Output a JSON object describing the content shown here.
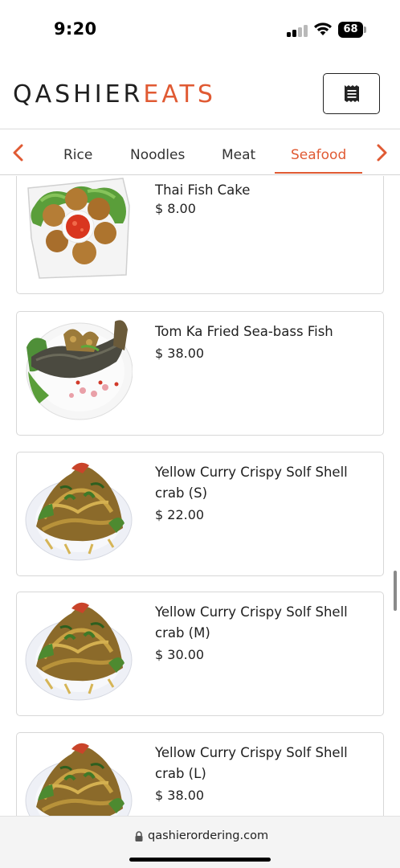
{
  "status_bar": {
    "time": "9:20",
    "battery": "68",
    "icons": [
      "signal-icon",
      "wifi-icon",
      "battery-icon"
    ]
  },
  "header": {
    "logo_part1": "QASHIER",
    "logo_part2": "EATS",
    "menu_icon": "receipt-icon"
  },
  "categories": {
    "tabs": [
      {
        "label": "Rice",
        "active": false
      },
      {
        "label": "Noodles",
        "active": false
      },
      {
        "label": "Meat",
        "active": false
      },
      {
        "label": "Seafood",
        "active": true
      }
    ],
    "prev_icon": "chevron-left-icon",
    "next_icon": "chevron-right-icon"
  },
  "items": [
    {
      "name": "Thai Fish Cake",
      "price": "$ 8.00"
    },
    {
      "name": "Tom Ka Fried Sea-bass Fish",
      "price": "$ 38.00"
    },
    {
      "name": "Yellow Curry Crispy Solf Shell crab (S)",
      "price": "$ 22.00"
    },
    {
      "name": "Yellow Curry Crispy Solf Shell crab (M)",
      "price": "$ 30.00"
    },
    {
      "name": "Yellow Curry Crispy Solf Shell crab (L)",
      "price": "$ 38.00"
    }
  ],
  "browser": {
    "url": "qashierordering.com"
  },
  "colors": {
    "accent": "#e05a33",
    "text": "#1f1f1f",
    "border": "#d7d7d7"
  }
}
